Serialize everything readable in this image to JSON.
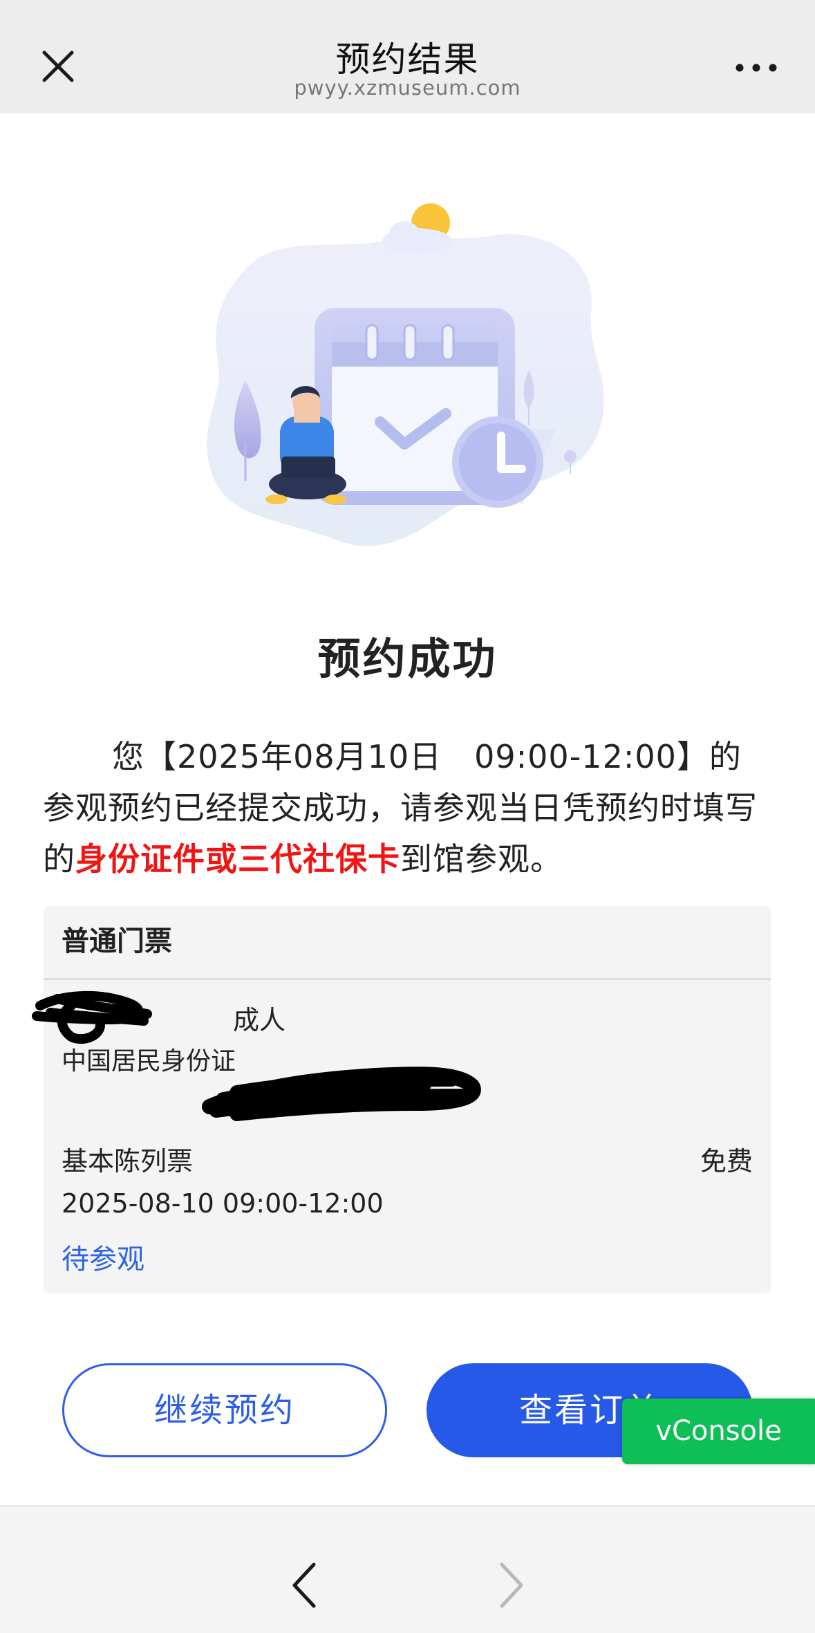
{
  "topbar": {
    "title": "预约结果",
    "domain": "pwyy.xzmuseum.com",
    "close_icon": "close-icon",
    "more_icon": "more-horizontal-icon"
  },
  "result": {
    "title": "预约成功",
    "message_part1": "您【2025年08月10日　09:00-12:00】的参观预约已经提交成功，请参观当日凭预约时填写的",
    "message_highlight": "身份证件或三代社保卡",
    "message_part2": "到馆参观。"
  },
  "ticket": {
    "header": "普通门票",
    "visitor_type": "成人",
    "id_type": "中国居民身份证",
    "ticket_name": "基本陈列票",
    "price": "免费",
    "time": "2025-08-10 09:00-12:00",
    "status": "待参观"
  },
  "actions": {
    "continue_label": "继续预约",
    "view_order_label": "查看订单"
  },
  "vconsole": {
    "label": "vConsole"
  },
  "colors": {
    "accent_blue": "#2659e8",
    "highlight_red": "#f21313",
    "status_blue": "#2c64e3",
    "vconsole_green": "#0ebf57"
  },
  "bottombar": {
    "back_icon": "chevron-left-icon",
    "forward_icon": "chevron-right-icon"
  }
}
